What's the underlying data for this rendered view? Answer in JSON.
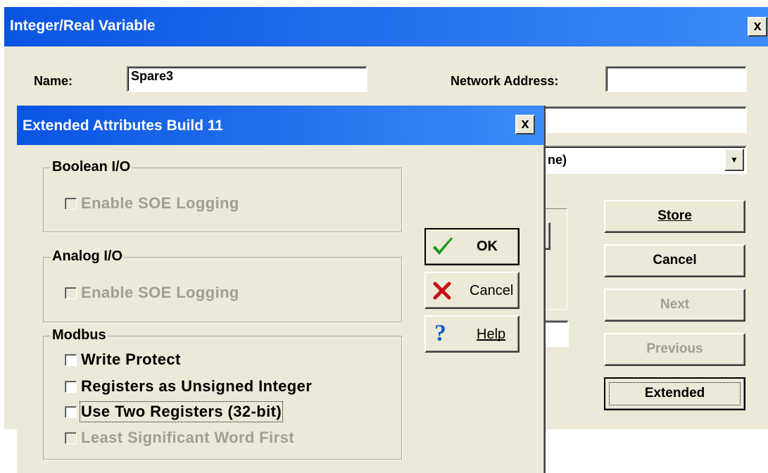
{
  "main_dialog": {
    "title": "Integer/Real Variable",
    "close_glyph": "x",
    "name_label": "Name:",
    "name_value": "Spare3",
    "network_address_label": "Network Address:",
    "network_address_value": "",
    "field2_value": "",
    "dropdown_visible_text": "ne)",
    "dropdown_arrow": "▼",
    "small_field_value": "",
    "buttons": {
      "store": "Store",
      "cancel": "Cancel",
      "next": "Next",
      "previous": "Previous",
      "extended": "Extended"
    }
  },
  "extended_dialog": {
    "title": "Extended Attributes Build 11",
    "close_glyph": "x",
    "boolean_io": {
      "legend": "Boolean I/O",
      "enable_soe_logging": {
        "label": "Enable SOE Logging",
        "checked": false,
        "enabled": false
      }
    },
    "analog_io": {
      "legend": "Analog I/O",
      "enable_soe_logging": {
        "label": "Enable SOE Logging",
        "checked": false,
        "enabled": false
      }
    },
    "modbus": {
      "legend": "Modbus",
      "write_protect": {
        "label": "Write Protect",
        "checked": false,
        "enabled": true
      },
      "registers_unsigned": {
        "label": "Registers as Unsigned Integer",
        "checked": false,
        "enabled": true
      },
      "two_registers": {
        "label": "Use Two Registers (32-bit)",
        "checked": false,
        "enabled": true
      },
      "lsw_first": {
        "label": "Least Significant Word First",
        "checked": false,
        "enabled": false
      }
    },
    "buttons": {
      "ok": "OK",
      "cancel": "Cancel",
      "help": "Help"
    },
    "icons": {
      "ok": "checkmark-icon",
      "cancel": "x-icon",
      "help": "question-icon"
    }
  },
  "colors": {
    "title_bar_start": "#0a54e3",
    "title_bar_end": "#3c8cf8",
    "dialog_face": "#ece9d8",
    "disabled_text": "#a09e94",
    "ok_green": "#1a9a1a",
    "cancel_red": "#c81010",
    "help_blue": "#1060d0"
  }
}
